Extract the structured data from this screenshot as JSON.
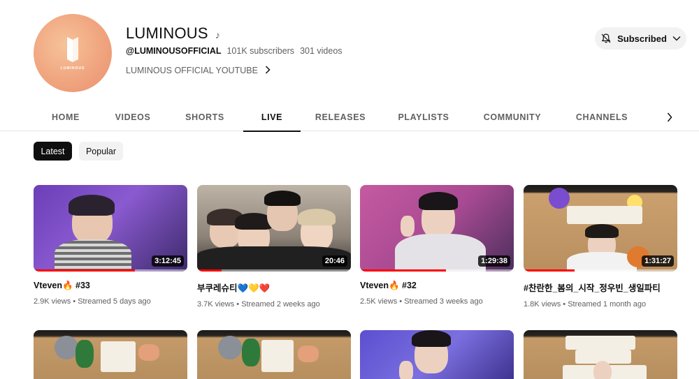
{
  "channel": {
    "name": "LUMINOUS",
    "logo_text": "LUMINOUS",
    "handle": "@LUMINOUSOFFICIAL",
    "subscribers": "101K subscribers",
    "videos_count": "301 videos",
    "description": "LUMINOUS OFFICIAL YOUTUBE",
    "subscribe_label": "Subscribed"
  },
  "tabs": [
    "HOME",
    "VIDEOS",
    "SHORTS",
    "LIVE",
    "RELEASES",
    "PLAYLISTS",
    "COMMUNITY",
    "CHANNELS"
  ],
  "active_tab": "LIVE",
  "chips": [
    "Latest",
    "Popular"
  ],
  "active_chip": "Latest",
  "videos": [
    {
      "title": "Vteven🔥 #33",
      "views": "2.9K views",
      "when": "Streamed 5 days ago",
      "duration": "3:12:45",
      "watched": 0.66
    },
    {
      "title": "부쿠레슈티💙💛❤️",
      "views": "3.7K views",
      "when": "Streamed 2 weeks ago",
      "duration": "20:46",
      "watched": 0.16
    },
    {
      "title": "Vteven🔥 #32",
      "views": "2.5K views",
      "when": "Streamed 3 weeks ago",
      "duration": "1:29:38",
      "watched": 0.56
    },
    {
      "title": "#찬란한_봄의_시작_정우빈_생일파티",
      "views": "1.8K views",
      "when": "Streamed 1 month ago",
      "duration": "1:31:27",
      "watched": 0.33
    }
  ],
  "colors": {
    "accent_red": "#ff0000",
    "text_primary": "#0f0f0f",
    "text_secondary": "#606060",
    "chip_bg": "#f2f2f2"
  }
}
